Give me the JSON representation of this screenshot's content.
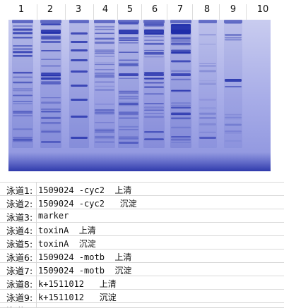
{
  "lanes": [
    "1",
    "2",
    "3",
    "4",
    "5",
    "6",
    "7",
    "8",
    "9",
    "10"
  ],
  "gel": {
    "background_color": "#8a93e0",
    "band_color": "#1c2aa8",
    "well_color": "#4f5bc4"
  },
  "caption_rows": [
    {
      "key": "泳道1:",
      "value": "1509024 -cyc2  上清"
    },
    {
      "key": "泳道2:",
      "value": "1509024 -cyc2   沉淀"
    },
    {
      "key": "泳道3:",
      "value": "marker"
    },
    {
      "key": "泳道4:",
      "value": "toxinA  上清"
    },
    {
      "key": "泳道5:",
      "value": "toxinA  沉淀"
    },
    {
      "key": "泳道6:",
      "value": "1509024 -motb  上清"
    },
    {
      "key": "泳道7:",
      "value": "1509024 -motb  沉淀"
    },
    {
      "key": "泳道8:",
      "value": "k+1511012   上清"
    },
    {
      "key": "泳道9:",
      "value": "k+1511012   沉淀"
    },
    {
      "key": "泳道1",
      "value": ""
    }
  ]
}
